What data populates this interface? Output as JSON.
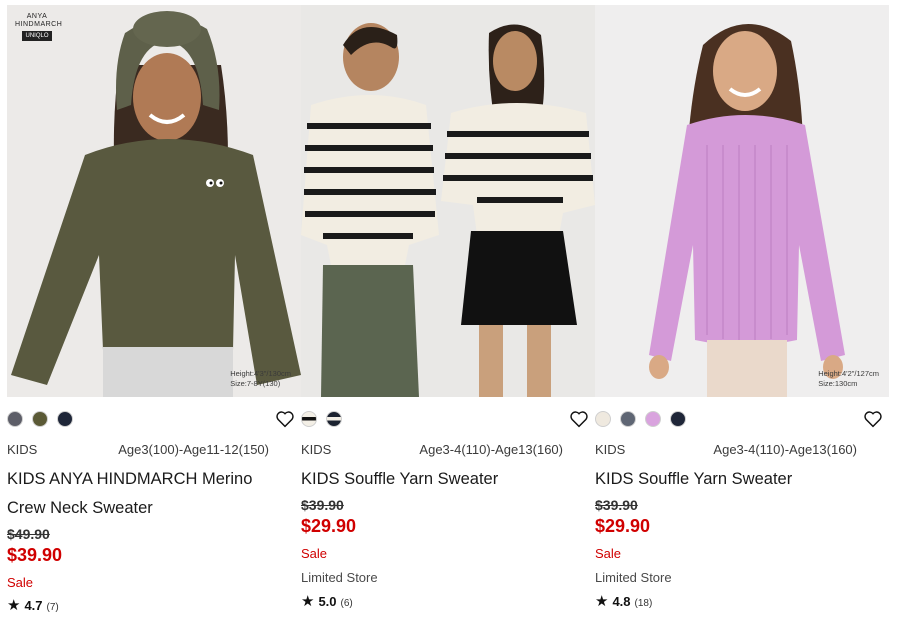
{
  "products": [
    {
      "photo_label": "Height:4'3\"/130cm",
      "photo_label_2": "Size:7-8Y(130)",
      "brand_logo": {
        "line1": "ANYA",
        "line2": "HINDMARCH",
        "badge": "UNIQLO"
      },
      "colors": [
        "#5d5e68",
        "#5b5a36",
        "#1e2638"
      ],
      "category": "KIDS",
      "sizes": "Age3(100)-Age11-12(150)",
      "name": "KIDS ANYA HINDMARCH Merino Crew Neck Sweater",
      "original_price": "$49.90",
      "sale_price": "$39.90",
      "sale_label": "Sale",
      "store_label": "",
      "rating": "4.7",
      "review_count": "(7)"
    },
    {
      "photo_label": "",
      "photo_label_2": "",
      "colors": [
        "stripe",
        "stripe-dark"
      ],
      "category": "KIDS",
      "sizes": "Age3-4(110)-Age13(160)",
      "name": "KIDS Souffle Yarn Sweater",
      "original_price": "$39.90",
      "sale_price": "$29.90",
      "sale_label": "Sale",
      "store_label": "Limited Store",
      "rating": "5.0",
      "review_count": "(6)"
    },
    {
      "photo_label": "Height:4'2\"/127cm",
      "photo_label_2": "Size:130cm",
      "colors": [
        "#efe9df",
        "#5f6674",
        "#d9a3de",
        "#1f2638"
      ],
      "category": "KIDS",
      "sizes": "Age3-4(110)-Age13(160)",
      "name": "KIDS Souffle Yarn Sweater",
      "original_price": "$39.90",
      "sale_price": "$29.90",
      "sale_label": "Sale",
      "store_label": "Limited Store",
      "rating": "4.8",
      "review_count": "(18)"
    }
  ],
  "colors": {
    "sale": "#d00000",
    "text": "#1b1b1b"
  }
}
